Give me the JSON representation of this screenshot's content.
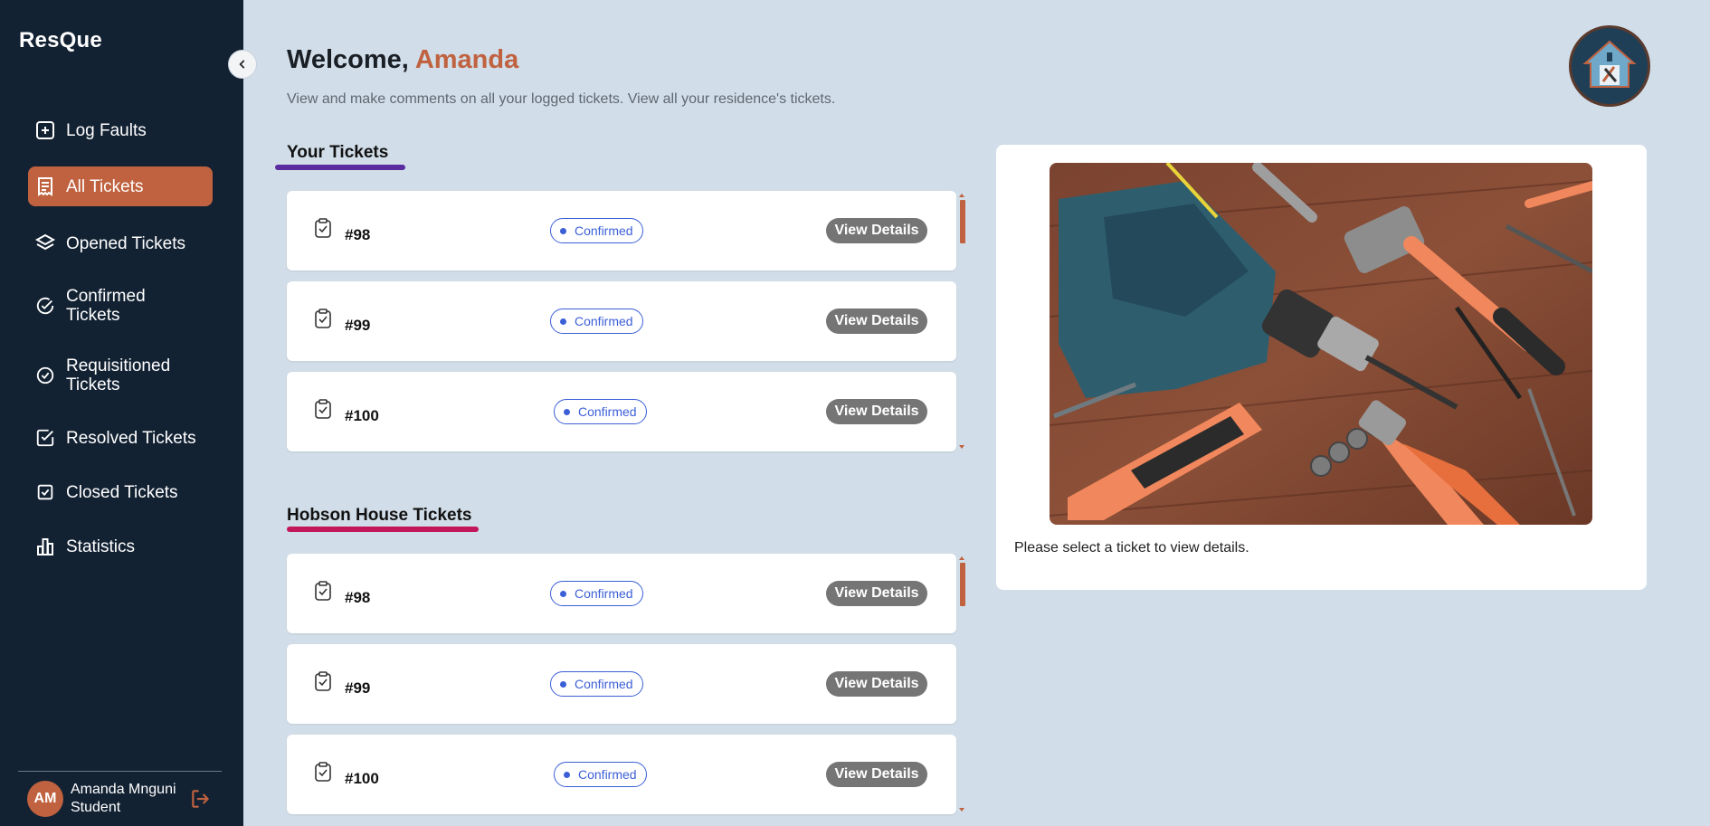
{
  "app": {
    "name": "ResQue"
  },
  "sidebar": {
    "items": [
      {
        "label": "Log Faults",
        "icon": "plus-square-icon"
      },
      {
        "label": "All Tickets",
        "icon": "receipt-icon",
        "active": true
      },
      {
        "label": "Opened Tickets",
        "icon": "layers-icon"
      },
      {
        "label": "Confirmed Tickets",
        "icon": "check-circle-icon"
      },
      {
        "label": "Requisitioned Tickets",
        "icon": "circle-check-icon"
      },
      {
        "label": "Resolved Tickets",
        "icon": "check-square-icon"
      },
      {
        "label": "Closed Tickets",
        "icon": "square-check-icon"
      },
      {
        "label": "Statistics",
        "icon": "bar-chart-icon"
      }
    ],
    "user": {
      "initials": "AM",
      "name": "Amanda Mnguni",
      "role": "Student"
    }
  },
  "header": {
    "greeting": "Welcome, ",
    "user_first_name": "Amanda",
    "subtitle": "View and make comments on all your logged tickets. View all your residence's tickets."
  },
  "your_tickets": {
    "title": "Your Tickets",
    "tickets": [
      {
        "id": "#98",
        "status": "Confirmed",
        "action": "View Details"
      },
      {
        "id": "#99",
        "status": "Confirmed",
        "action": "View Details"
      },
      {
        "id": "#100",
        "status": "Confirmed",
        "action": "View Details"
      }
    ]
  },
  "house_tickets": {
    "title": "Hobson House Tickets",
    "tickets": [
      {
        "id": "#98",
        "status": "Confirmed",
        "action": "View Details"
      },
      {
        "id": "#99",
        "status": "Confirmed",
        "action": "View Details"
      },
      {
        "id": "#100",
        "status": "Confirmed",
        "action": "View Details"
      }
    ]
  },
  "detail_panel": {
    "image": "tools-photo",
    "message": "Please select a ticket to view details."
  },
  "colors": {
    "sidebar_bg": "#132233",
    "accent": "#c0623f",
    "page_bg": "#d1dde8",
    "status_blue": "#3b5fd6",
    "your_tickets_underline": "#5b2ca0",
    "house_tickets_underline": "#c2185b"
  }
}
